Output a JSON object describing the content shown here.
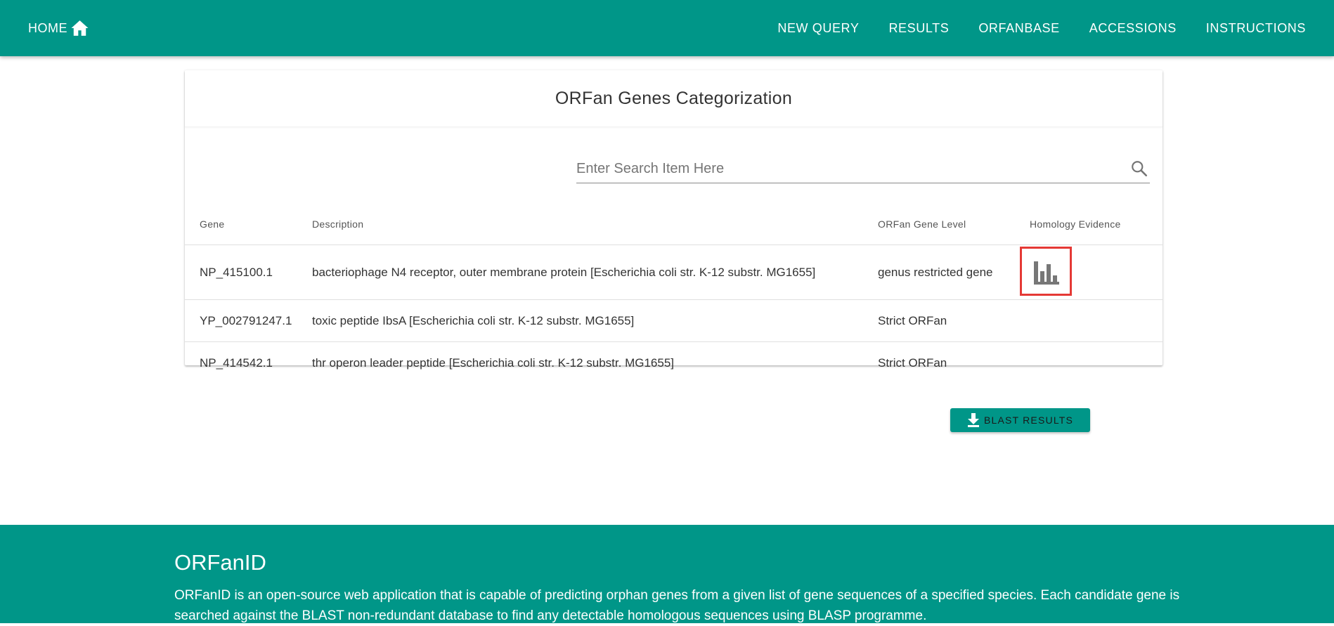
{
  "nav": {
    "home_label": "HOME",
    "home_icon": "home-icon",
    "links": [
      "NEW QUERY",
      "RESULTS",
      "ORFANBASE",
      "ACCESSIONS",
      "INSTRUCTIONS"
    ]
  },
  "card": {
    "title": "ORFan Genes Categorization",
    "search": {
      "placeholder": "Enter Search Item Here",
      "value": "",
      "icon": "search-icon"
    },
    "columns": [
      "Gene",
      "Description",
      "ORFan Gene Level",
      "Homology Evidence"
    ],
    "rows": [
      {
        "gene": "NP_415100.1",
        "description": "bacteriophage N4 receptor, outer membrane protein [Escherichia coli str. K-12 substr. MG1655]",
        "level": "genus restricted gene",
        "evidence_icon": "bar-chart-icon"
      },
      {
        "gene": "YP_002791247.1",
        "description": "toxic peptide IbsA [Escherichia coli str. K-12 substr. MG1655]",
        "level": "Strict ORFan"
      },
      {
        "gene": "NP_414542.1",
        "description": "thr operon leader peptide [Escherichia coli str. K-12 substr. MG1655]",
        "level": "Strict ORFan"
      }
    ]
  },
  "download": {
    "label": "BLAST RESULTS",
    "icon": "download-icon"
  },
  "footer": {
    "title": "ORFanID",
    "text": "ORFanID is an open-source web application that is capable of predicting orphan genes from a given list of gene sequences of a specified species. Each candidate gene is searched against the BLAST non-redundant database to find any detectable homologous sequences using BLASP programme."
  },
  "colors": {
    "primary": "#009688",
    "highlight": "#e53935"
  }
}
